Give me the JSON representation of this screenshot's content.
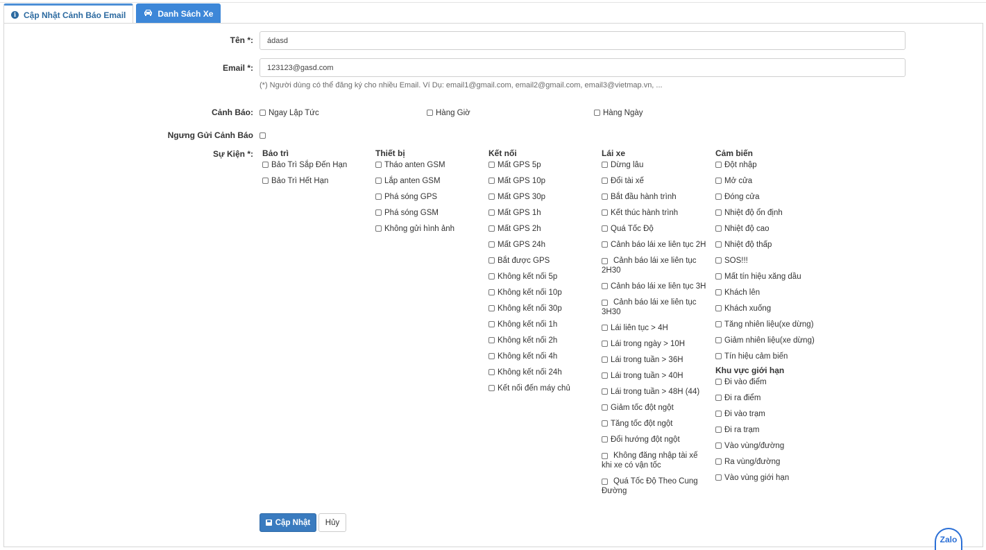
{
  "tabs": [
    {
      "label": "Cập Nhật Cảnh Báo Email",
      "icon": "info-circle-icon",
      "active": true
    },
    {
      "label": "Danh Sách Xe",
      "icon": "car-icon",
      "active": false
    }
  ],
  "form": {
    "name_label": "Tên *:",
    "name_value": "ádasd",
    "email_label": "Email *:",
    "email_value": "123123@gasd.com",
    "email_hint": "(*) Người dùng có thể đăng ký cho nhiều Email. Ví Dụ: email1@gmail.com, email2@gmail.com, email3@vietmap.vn, ...",
    "alert_label": "Cảnh Báo:",
    "alert_options": [
      "Ngay Lập Tức",
      "Hàng Giờ",
      "Hàng Ngày"
    ],
    "stop_label": "Ngưng Gửi Cảnh Báo",
    "events_label": "Sự Kiện *:"
  },
  "events": {
    "baotri": {
      "title": "Bảo trì",
      "items": [
        "Bảo Trì Sắp Đến Hạn",
        "Bảo Trì Hết Hạn"
      ]
    },
    "thietbi": {
      "title": "Thiết bị",
      "items": [
        "Tháo anten GSM",
        "Lắp anten GSM",
        "Phá sóng GPS",
        "Phá sóng GSM",
        "Không gửi hình ảnh"
      ]
    },
    "ketnoi": {
      "title": "Kết nối",
      "items": [
        "Mất GPS 5p",
        "Mất GPS 10p",
        "Mất GPS 30p",
        "Mất GPS 1h",
        "Mất GPS 2h",
        "Mất GPS 24h",
        "Bắt được GPS",
        "Không kết nối 5p",
        "Không kết nối 10p",
        "Không kết nối 30p",
        "Không kết nối 1h",
        "Không kết nối 2h",
        "Không kết nối 4h",
        "Không kết nối 24h",
        "Kết nối đến máy chủ"
      ]
    },
    "laixe": {
      "title": "Lái xe",
      "items": [
        "Dừng lâu",
        "Đổi tài xế",
        "Bắt đầu hành trình",
        "Kết thúc hành trình",
        "Quá Tốc Độ",
        "Cảnh báo lái xe liên tục 2H",
        "Cảnh báo lái xe liên tục 2H30",
        "Cảnh báo lái xe liên tục 3H",
        "Cảnh báo lái xe liên tục 3H30",
        "Lái liên tục > 4H",
        "Lái trong ngày > 10H",
        "Lái trong tuần > 36H",
        "Lái trong tuần > 40H",
        "Lái trong tuần > 48H (44)",
        "Giảm tốc đột ngột",
        "Tăng tốc đột ngột",
        "Đổi hướng đột ngột",
        "Không đăng nhập tài xế khi xe có vận tốc",
        "Quá Tốc Độ Theo Cung Đường"
      ]
    },
    "cambien": {
      "title": "Cảm biến",
      "items": [
        "Đột nhập",
        "Mở cửa",
        "Đóng cửa",
        "Nhiệt độ ổn định",
        "Nhiệt độ cao",
        "Nhiệt độ thấp",
        "SOS!!!",
        "Mất tín hiệu xăng dầu",
        "Khách lên",
        "Khách xuống",
        "Tăng nhiên liệu(xe dừng)",
        "Giảm nhiên liệu(xe dừng)",
        "Tín hiệu cảm biến"
      ]
    },
    "khuvuc": {
      "title": "Khu vực giới hạn",
      "items": [
        "Đi vào điểm",
        "Đi ra điểm",
        "Đi vào trạm",
        "Đi ra trạm",
        "Vào vùng/đường",
        "Ra vùng/đường",
        "Vào vùng giới hạn"
      ]
    }
  },
  "buttons": {
    "update": "Cập Nhật",
    "cancel": "Hủy"
  },
  "widget": {
    "zalo": "Zalo"
  },
  "colors": {
    "accent": "#3a7bbf",
    "tab_inactive": "#3d87d8"
  }
}
